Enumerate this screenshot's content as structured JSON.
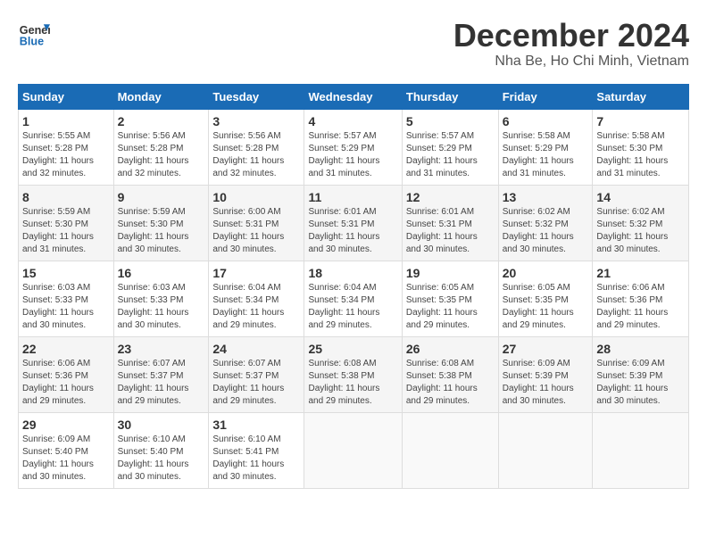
{
  "header": {
    "logo_line1": "General",
    "logo_line2": "Blue",
    "title": "December 2024",
    "subtitle": "Nha Be, Ho Chi Minh, Vietnam"
  },
  "days_of_week": [
    "Sunday",
    "Monday",
    "Tuesday",
    "Wednesday",
    "Thursday",
    "Friday",
    "Saturday"
  ],
  "weeks": [
    [
      {
        "day": "1",
        "info": "Sunrise: 5:55 AM\nSunset: 5:28 PM\nDaylight: 11 hours\nand 32 minutes."
      },
      {
        "day": "2",
        "info": "Sunrise: 5:56 AM\nSunset: 5:28 PM\nDaylight: 11 hours\nand 32 minutes."
      },
      {
        "day": "3",
        "info": "Sunrise: 5:56 AM\nSunset: 5:28 PM\nDaylight: 11 hours\nand 32 minutes."
      },
      {
        "day": "4",
        "info": "Sunrise: 5:57 AM\nSunset: 5:29 PM\nDaylight: 11 hours\nand 31 minutes."
      },
      {
        "day": "5",
        "info": "Sunrise: 5:57 AM\nSunset: 5:29 PM\nDaylight: 11 hours\nand 31 minutes."
      },
      {
        "day": "6",
        "info": "Sunrise: 5:58 AM\nSunset: 5:29 PM\nDaylight: 11 hours\nand 31 minutes."
      },
      {
        "day": "7",
        "info": "Sunrise: 5:58 AM\nSunset: 5:30 PM\nDaylight: 11 hours\nand 31 minutes."
      }
    ],
    [
      {
        "day": "8",
        "info": "Sunrise: 5:59 AM\nSunset: 5:30 PM\nDaylight: 11 hours\nand 31 minutes."
      },
      {
        "day": "9",
        "info": "Sunrise: 5:59 AM\nSunset: 5:30 PM\nDaylight: 11 hours\nand 30 minutes."
      },
      {
        "day": "10",
        "info": "Sunrise: 6:00 AM\nSunset: 5:31 PM\nDaylight: 11 hours\nand 30 minutes."
      },
      {
        "day": "11",
        "info": "Sunrise: 6:01 AM\nSunset: 5:31 PM\nDaylight: 11 hours\nand 30 minutes."
      },
      {
        "day": "12",
        "info": "Sunrise: 6:01 AM\nSunset: 5:31 PM\nDaylight: 11 hours\nand 30 minutes."
      },
      {
        "day": "13",
        "info": "Sunrise: 6:02 AM\nSunset: 5:32 PM\nDaylight: 11 hours\nand 30 minutes."
      },
      {
        "day": "14",
        "info": "Sunrise: 6:02 AM\nSunset: 5:32 PM\nDaylight: 11 hours\nand 30 minutes."
      }
    ],
    [
      {
        "day": "15",
        "info": "Sunrise: 6:03 AM\nSunset: 5:33 PM\nDaylight: 11 hours\nand 30 minutes."
      },
      {
        "day": "16",
        "info": "Sunrise: 6:03 AM\nSunset: 5:33 PM\nDaylight: 11 hours\nand 30 minutes."
      },
      {
        "day": "17",
        "info": "Sunrise: 6:04 AM\nSunset: 5:34 PM\nDaylight: 11 hours\nand 29 minutes."
      },
      {
        "day": "18",
        "info": "Sunrise: 6:04 AM\nSunset: 5:34 PM\nDaylight: 11 hours\nand 29 minutes."
      },
      {
        "day": "19",
        "info": "Sunrise: 6:05 AM\nSunset: 5:35 PM\nDaylight: 11 hours\nand 29 minutes."
      },
      {
        "day": "20",
        "info": "Sunrise: 6:05 AM\nSunset: 5:35 PM\nDaylight: 11 hours\nand 29 minutes."
      },
      {
        "day": "21",
        "info": "Sunrise: 6:06 AM\nSunset: 5:36 PM\nDaylight: 11 hours\nand 29 minutes."
      }
    ],
    [
      {
        "day": "22",
        "info": "Sunrise: 6:06 AM\nSunset: 5:36 PM\nDaylight: 11 hours\nand 29 minutes."
      },
      {
        "day": "23",
        "info": "Sunrise: 6:07 AM\nSunset: 5:37 PM\nDaylight: 11 hours\nand 29 minutes."
      },
      {
        "day": "24",
        "info": "Sunrise: 6:07 AM\nSunset: 5:37 PM\nDaylight: 11 hours\nand 29 minutes."
      },
      {
        "day": "25",
        "info": "Sunrise: 6:08 AM\nSunset: 5:38 PM\nDaylight: 11 hours\nand 29 minutes."
      },
      {
        "day": "26",
        "info": "Sunrise: 6:08 AM\nSunset: 5:38 PM\nDaylight: 11 hours\nand 29 minutes."
      },
      {
        "day": "27",
        "info": "Sunrise: 6:09 AM\nSunset: 5:39 PM\nDaylight: 11 hours\nand 30 minutes."
      },
      {
        "day": "28",
        "info": "Sunrise: 6:09 AM\nSunset: 5:39 PM\nDaylight: 11 hours\nand 30 minutes."
      }
    ],
    [
      {
        "day": "29",
        "info": "Sunrise: 6:09 AM\nSunset: 5:40 PM\nDaylight: 11 hours\nand 30 minutes."
      },
      {
        "day": "30",
        "info": "Sunrise: 6:10 AM\nSunset: 5:40 PM\nDaylight: 11 hours\nand 30 minutes."
      },
      {
        "day": "31",
        "info": "Sunrise: 6:10 AM\nSunset: 5:41 PM\nDaylight: 11 hours\nand 30 minutes."
      },
      {
        "day": "",
        "info": ""
      },
      {
        "day": "",
        "info": ""
      },
      {
        "day": "",
        "info": ""
      },
      {
        "day": "",
        "info": ""
      }
    ]
  ]
}
